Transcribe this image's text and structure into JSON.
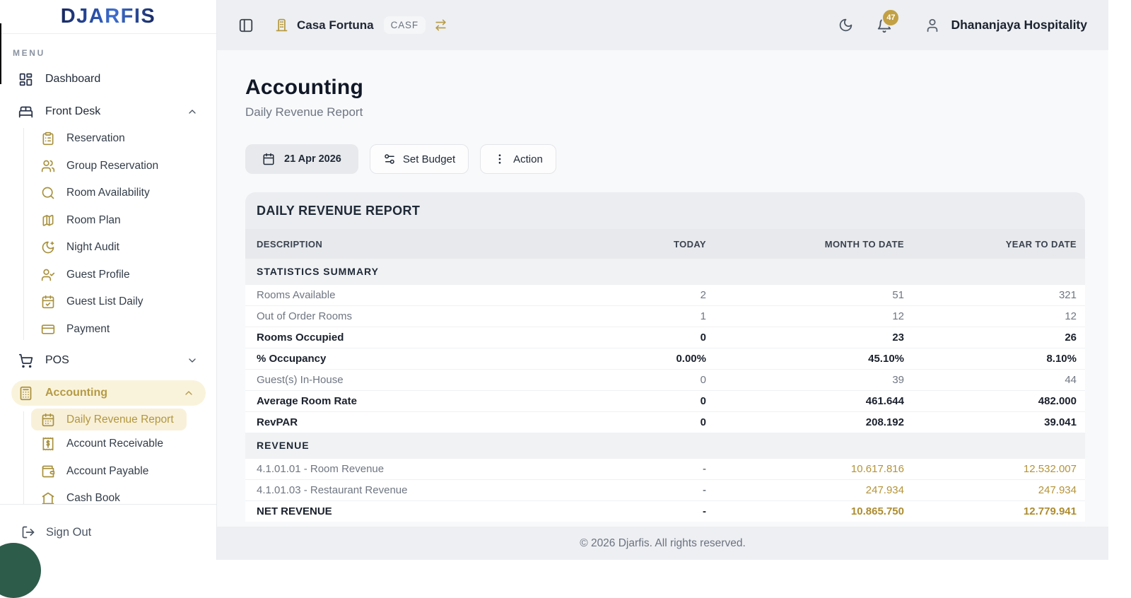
{
  "brand": {
    "logo": "DJARFIS",
    "menu_label": "MENU"
  },
  "sidebar": {
    "dashboard": {
      "label": "Dashboard"
    },
    "front_desk": {
      "label": "Front Desk",
      "children": [
        {
          "label": "Reservation"
        },
        {
          "label": "Group Reservation"
        },
        {
          "label": "Room Availability"
        },
        {
          "label": "Room Plan"
        },
        {
          "label": "Night Audit"
        },
        {
          "label": "Guest Profile"
        },
        {
          "label": "Guest List Daily"
        },
        {
          "label": "Payment"
        }
      ]
    },
    "pos": {
      "label": "POS"
    },
    "accounting": {
      "label": "Accounting",
      "children": [
        {
          "label": "Daily Revenue Report",
          "active": true
        },
        {
          "label": "Account Receivable"
        },
        {
          "label": "Account Payable"
        },
        {
          "label": "Cash Book",
          "partially_visible": true
        }
      ]
    },
    "sign_out": "Sign Out"
  },
  "topbar": {
    "property_name": "Casa Fortuna",
    "property_code": "CASF",
    "notification_count": "47",
    "account_name": "Dhananjaya Hospitality"
  },
  "page": {
    "title": "Accounting",
    "subtitle": "Daily Revenue Report",
    "date_button": "21 Apr 2026",
    "set_budget_button": "Set Budget",
    "action_button": "Action"
  },
  "report": {
    "title": "DAILY REVENUE REPORT",
    "columns": {
      "description": "DESCRIPTION",
      "today": "TODAY",
      "mtd": "MONTH TO DATE",
      "ytd": "YEAR TO DATE"
    },
    "sections": [
      {
        "title": "STATISTICS SUMMARY",
        "rows": [
          {
            "label": "Rooms Available",
            "today": "2",
            "mtd": "51",
            "ytd": "321"
          },
          {
            "label": "Out of Order Rooms",
            "today": "1",
            "mtd": "12",
            "ytd": "12"
          },
          {
            "label": "Rooms Occupied",
            "today": "0",
            "mtd": "23",
            "ytd": "26"
          },
          {
            "label": "% Occupancy",
            "today": "0.00%",
            "mtd": "45.10%",
            "ytd": "8.10%"
          },
          {
            "label": "Guest(s) In-House",
            "today": "0",
            "mtd": "39",
            "ytd": "44"
          },
          {
            "label": "Average Room Rate",
            "today": "0",
            "mtd": "461.644",
            "ytd": "482.000"
          },
          {
            "label": "RevPAR",
            "today": "0",
            "mtd": "208.192",
            "ytd": "39.041"
          }
        ]
      },
      {
        "title": "REVENUE",
        "rows": [
          {
            "label": "4.1.01.01 - Room Revenue",
            "today": "-",
            "mtd": "10.617.816",
            "ytd": "12.532.007"
          },
          {
            "label": "4.1.01.03 - Restaurant Revenue",
            "today": "-",
            "mtd": "247.934",
            "ytd": "247.934"
          },
          {
            "label": "NET REVENUE",
            "today": "-",
            "mtd": "10.865.750",
            "ytd": "12.779.941"
          }
        ]
      }
    ]
  },
  "footer": {
    "copyright": "© 2026 Djarfis. All rights reserved."
  },
  "colors": {
    "accent_gold": "#a8913e",
    "highlight_cream": "#faf3dc",
    "logo_navy": "#1d3374",
    "badge_gold": "#c2a044",
    "revenue_gold": "#b49339",
    "topbar_gray": "#edeff2",
    "chat_bubble_green": "#2d5c4b"
  }
}
